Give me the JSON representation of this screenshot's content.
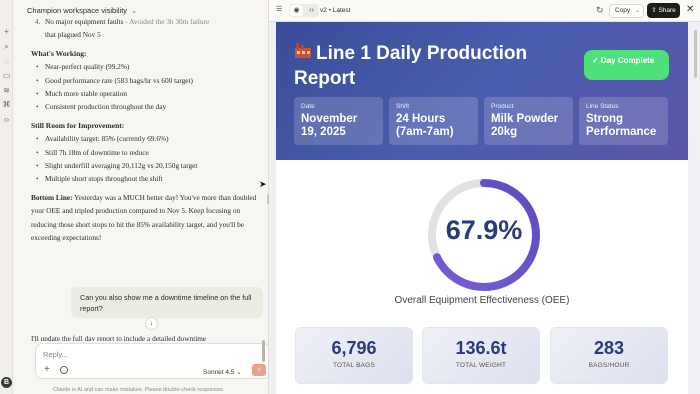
{
  "chat": {
    "title": "Champion workspace visibility",
    "list_item_4_num": "4.",
    "list_item_4_text": "No major equipment faults",
    "list_item_4_muted": " - Avoided the 3h 30m failure",
    "list_item_4_cont": "that plagued Nov 5",
    "working_heading": "What's Working:",
    "working_items": [
      "Near-perfect quality (99.2%)",
      "Good performance rate (583 bags/hr vs 600 target)",
      "Much more stable operation",
      "Consistent production throughout the day"
    ],
    "improve_heading": "Still Room for Improvement:",
    "improve_items": [
      "Availability target: 85% (currently 69.6%)",
      "Still 7h 18m of downtime to reduce",
      "Slight underfill averaging 20,112g vs 20,150g target",
      "Multiple short stops throughout the shift"
    ],
    "bottom_line_label": "Bottom Line:",
    "bottom_line_text": " Yesterday was a MUCH better day! You've more than doubled your OEE and tripled production compared to Nov 5. Keep focusing on reducing those short stops to hit the 85% availability target, and you'll be exceeding expectations!",
    "user_message": "Can you also show me a downtime timeline on the full report?",
    "partial_reply": "I'll update the full day report to include a detailed downtime",
    "composer_placeholder": "Reply...",
    "model": "Sonnet 4.5",
    "disclaimer": "Claude is AI and can make mistakes. Please double-check responses.",
    "avatar_initial": "B"
  },
  "artifact_bar": {
    "version": "v2 • Latest",
    "copy_label": "Copy",
    "share_label": "Share"
  },
  "report": {
    "title": "Line 1 Daily Production Report",
    "badge": "✓ Day Complete",
    "cards": [
      {
        "label": "Date",
        "value": "November 19, 2025"
      },
      {
        "label": "Shift",
        "value": "24 Hours (7am-7am)"
      },
      {
        "label": "Product",
        "value": "Milk Powder 20kg"
      },
      {
        "label": "Line Status",
        "value": "Strong Performance"
      }
    ],
    "oee_value": 67.9,
    "oee_text": "67.9%",
    "oee_label": "Overall Equipment Effectiveness (OEE)",
    "stats": [
      {
        "value": "6,796",
        "label": "TOTAL BAGS"
      },
      {
        "value": "136.6t",
        "label": "TOTAL WEIGHT"
      },
      {
        "value": "283",
        "label": "BAGS/HOUR"
      }
    ]
  },
  "colors": {
    "hero_start": "#3a4d97",
    "badge_green": "#4ee07a",
    "gauge_track": "#e2e2e6",
    "gauge_fill": "#6a4fc9"
  }
}
